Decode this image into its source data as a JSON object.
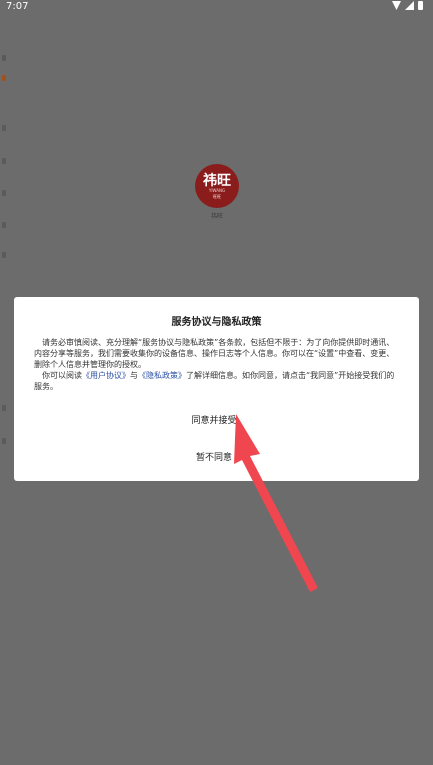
{
  "status_bar": {
    "time": "7:07"
  },
  "app": {
    "logo_text_top": "祎旺",
    "logo_text_mid": "YIWANG",
    "logo_text_bottom": "旺旺",
    "name": "祎旺"
  },
  "dialog": {
    "title": "服务协议与隐私政策",
    "body_p1": "请务必审慎阅读、充分理解“服务协议与隐私政策”各条款，包括但不限于：为了向你提供即时通讯、内容分享等服务，我们需要收集你的设备信息、操作日志等个人信息。你可以在“设置”中查看、变更、删除个人信息并管理你的授权。",
    "body_p2_prefix": "你可以阅读",
    "link_user_agreement": "《用户协议》",
    "body_p2_and": "与",
    "link_privacy_policy": "《隐私政策》",
    "body_p2_suffix": "了解详细信息。如你同意，请点击“我同意”开始接受我们的服务。",
    "agree_label": "同意并接受",
    "disagree_label": "暂不同意"
  },
  "colors": {
    "overlay": "#6c6c6c",
    "link": "#2b4ea5",
    "arrow": "#f0464f"
  }
}
